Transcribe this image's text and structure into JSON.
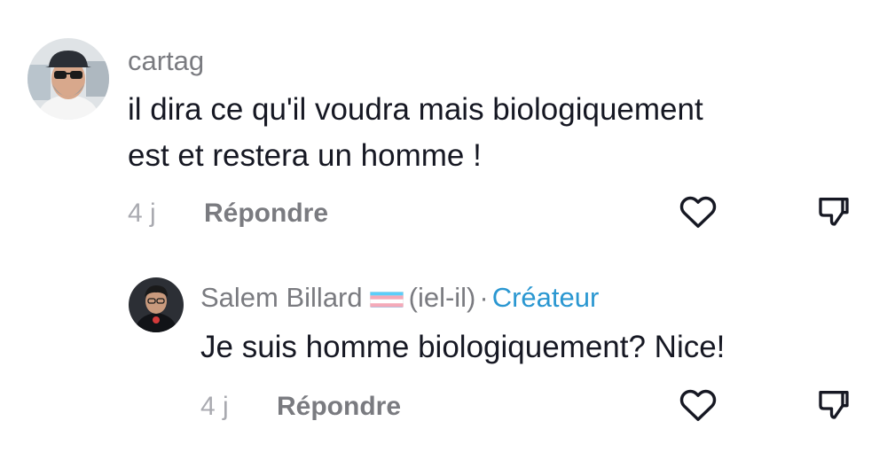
{
  "comments": [
    {
      "username": "cartag",
      "text_lines": [
        "il dira ce qu'il voudra mais biologiquement",
        "est et restera un homme !"
      ],
      "time": "4 j",
      "reply_label": "Répondre"
    },
    {
      "username": "Salem Billard",
      "pronouns": "(iel-il)",
      "separator": "·",
      "badge": "Créateur",
      "text": "Je suis homme biologiquement? Nice!",
      "time": "4 j",
      "reply_label": "Répondre"
    }
  ],
  "icons": {
    "like": "heart-icon",
    "dislike": "thumbs-down-icon",
    "flag": "transgender-flag-icon"
  },
  "colors": {
    "creator_badge": "#2a97d1",
    "secondary_text": "#7a7b80",
    "primary_text": "#161823"
  }
}
